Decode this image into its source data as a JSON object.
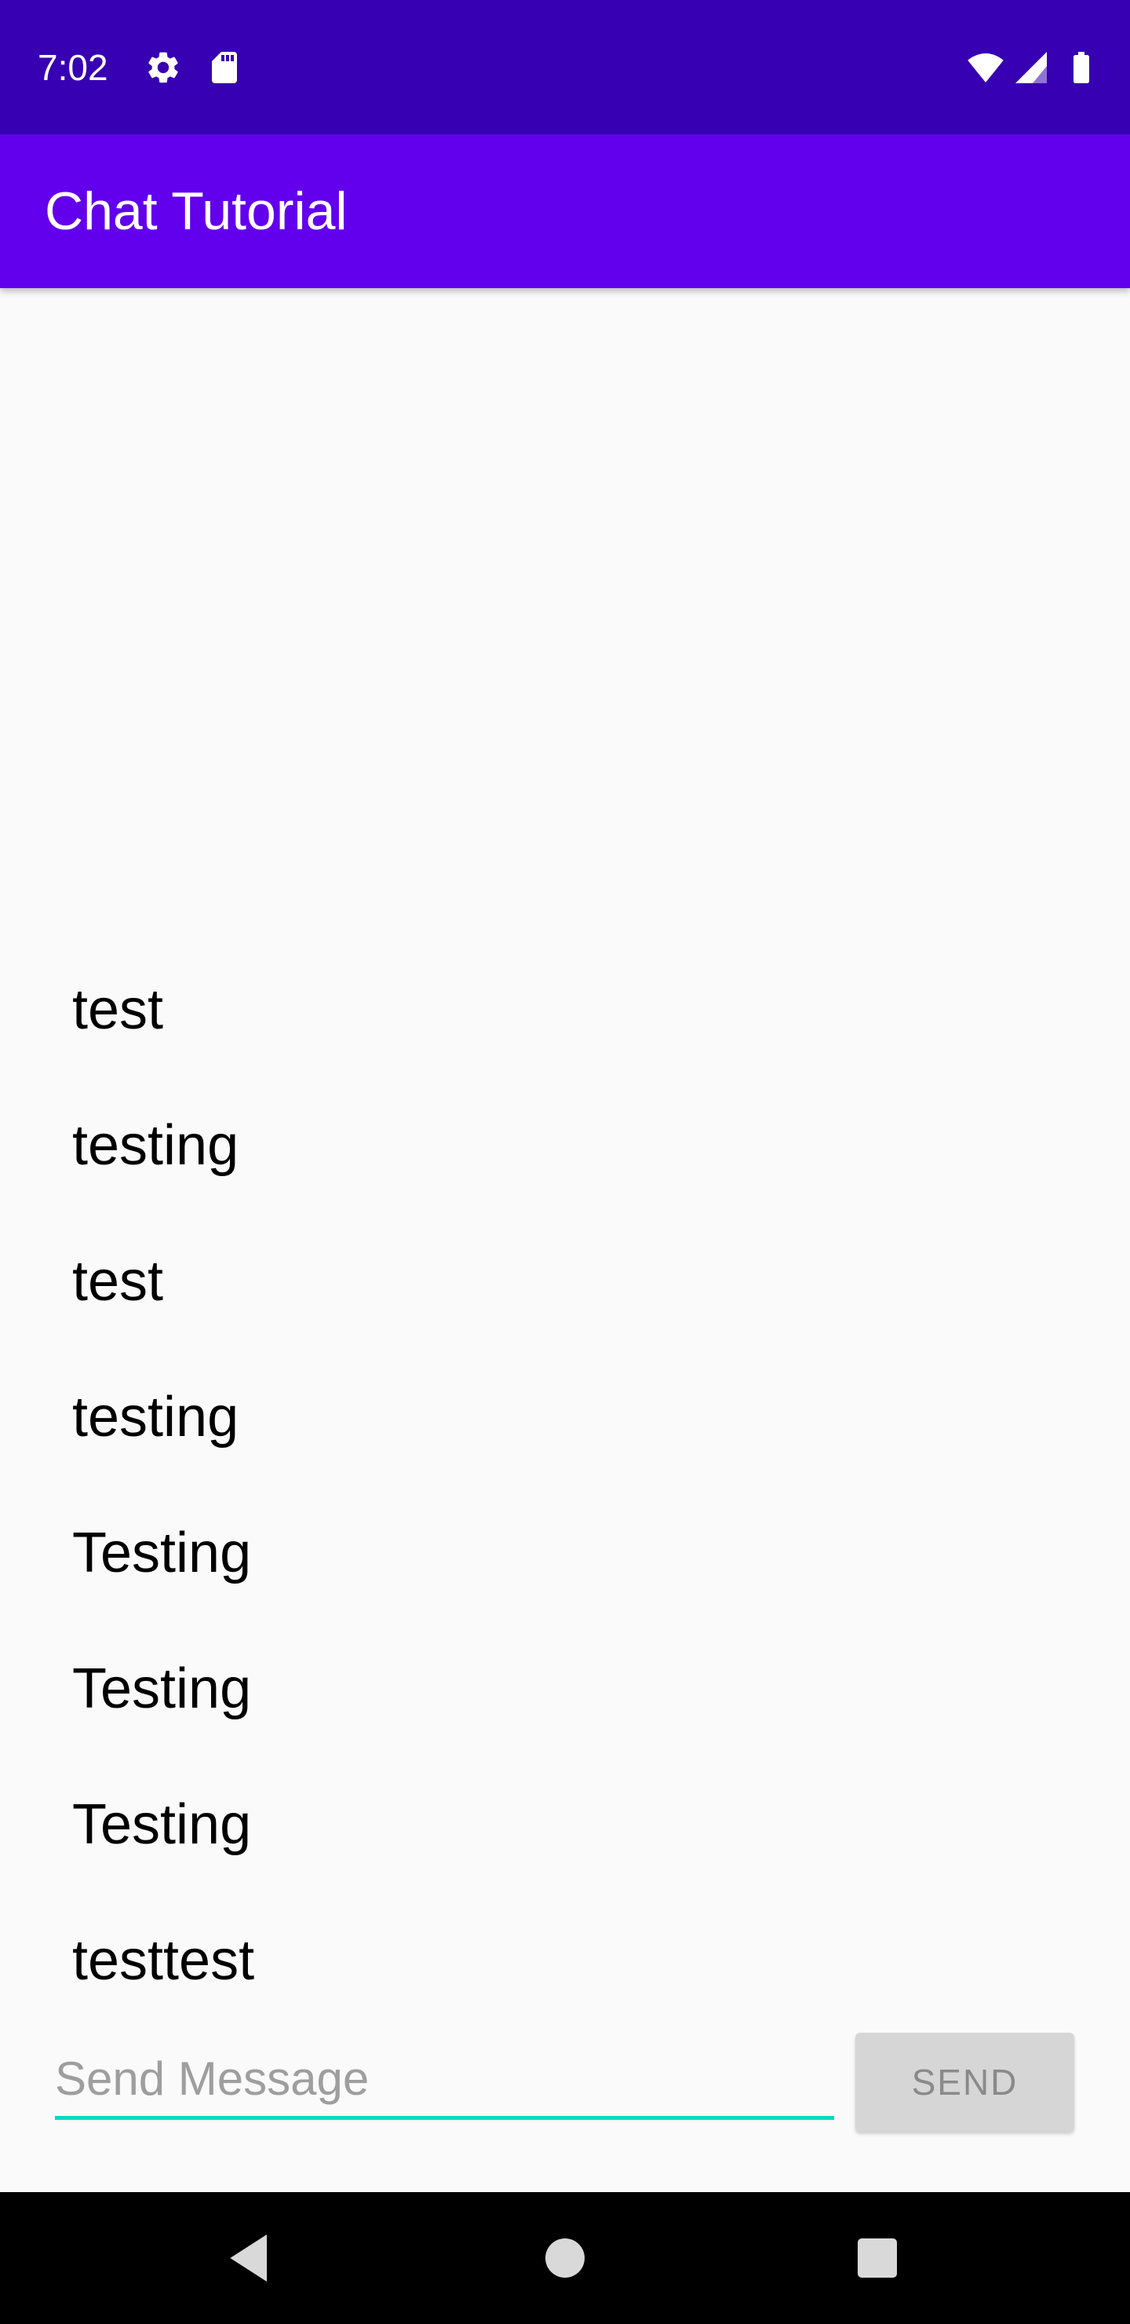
{
  "status_bar": {
    "time": "7:02",
    "icons": [
      "gear-icon",
      "sd-card-icon",
      "wifi-icon",
      "cell-signal-icon",
      "battery-icon"
    ],
    "background_color": "#3700b3"
  },
  "app_bar": {
    "title": "Chat Tutorial",
    "background_color": "#6200ee"
  },
  "messages": [
    {
      "text": "test"
    },
    {
      "text": "testing"
    },
    {
      "text": "test"
    },
    {
      "text": "testing"
    },
    {
      "text": "Testing"
    },
    {
      "text": "Testing"
    },
    {
      "text": "Testing"
    },
    {
      "text": "testtest"
    }
  ],
  "composer": {
    "input_value": "",
    "input_placeholder": "Send Message",
    "send_label": "SEND",
    "accent_color": "#03dac5"
  },
  "nav_bar": {
    "buttons": [
      "back-icon",
      "home-icon",
      "recents-icon"
    ]
  }
}
